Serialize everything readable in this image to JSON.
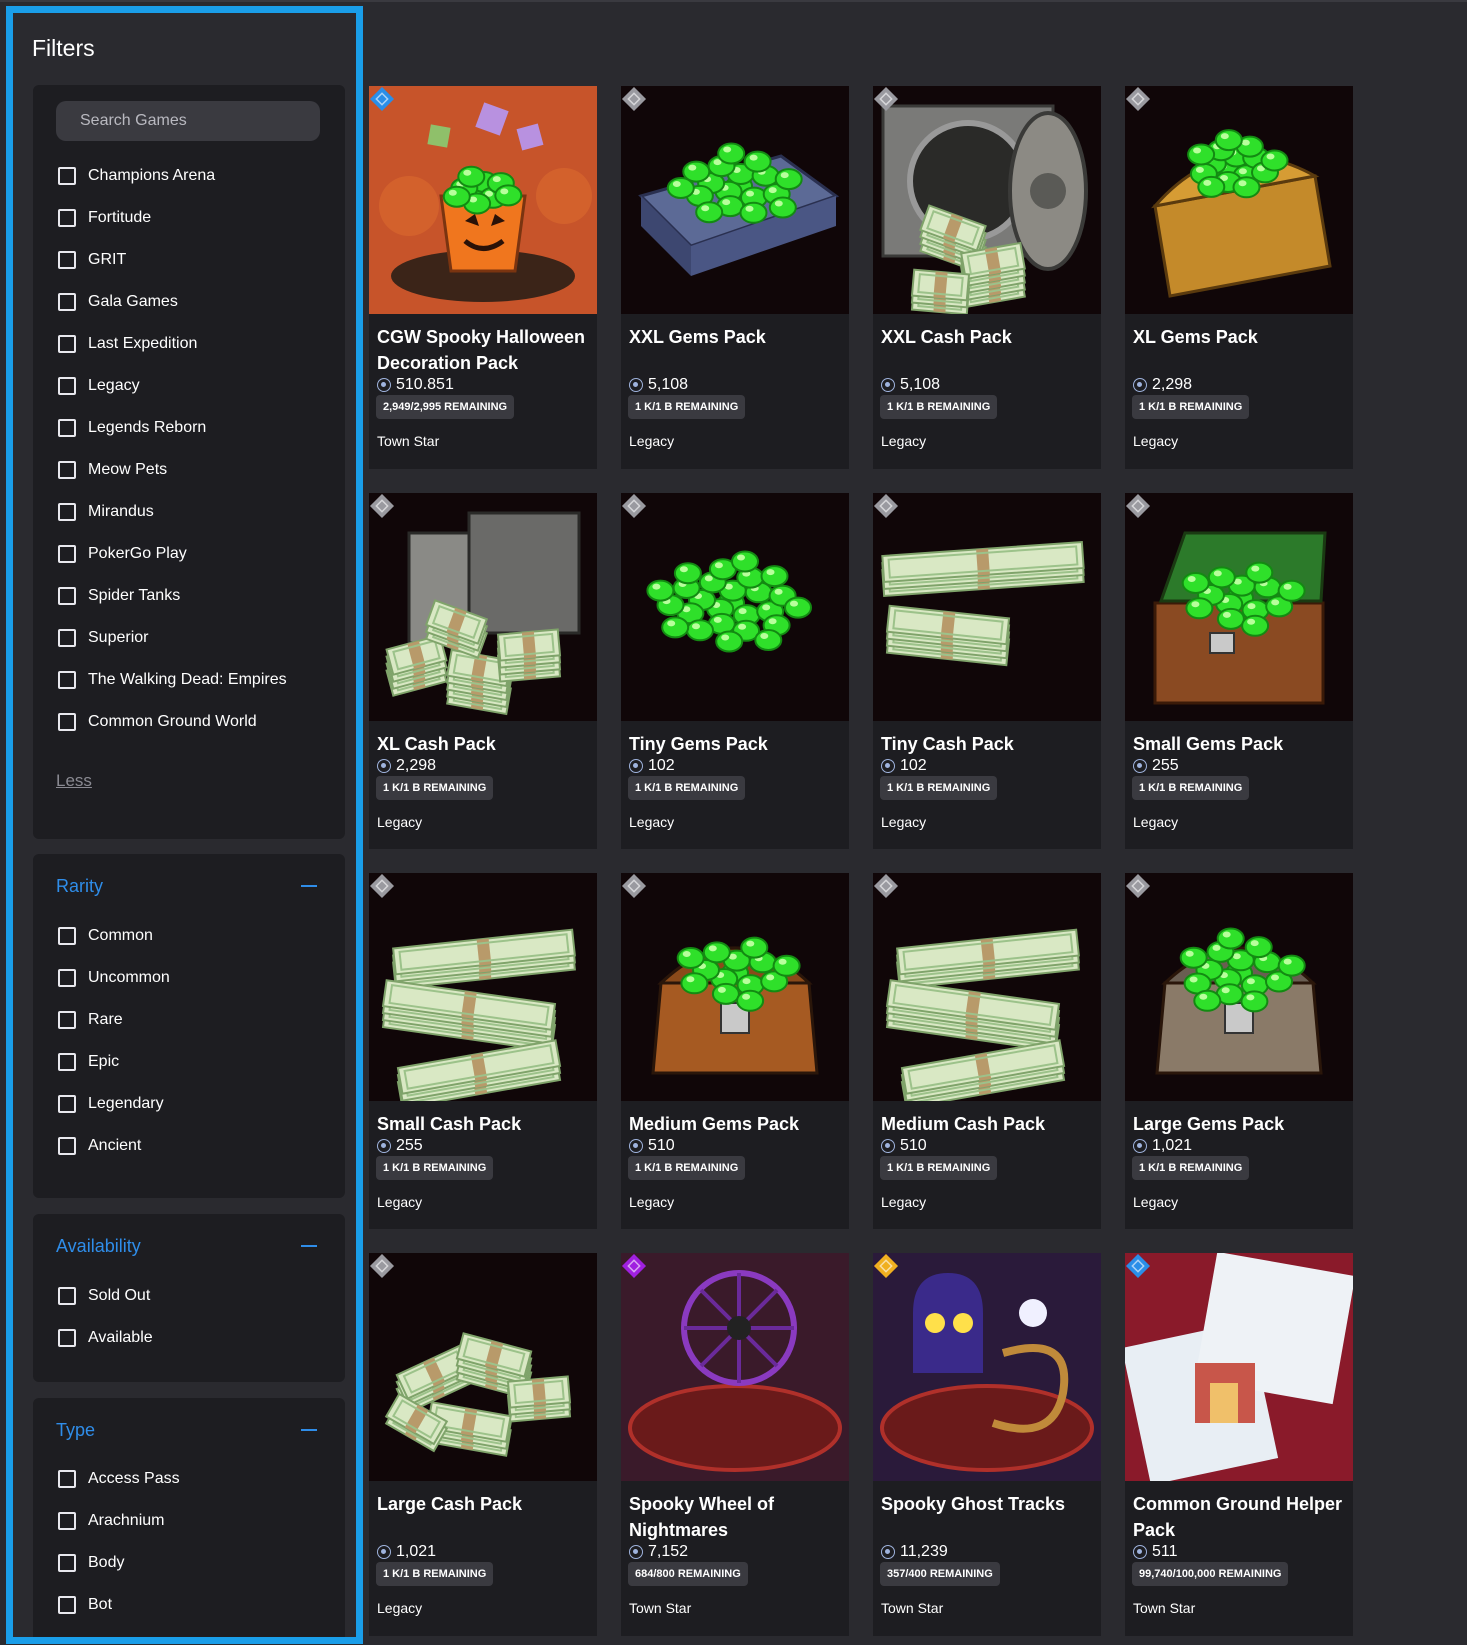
{
  "sidebar": {
    "title": "Filters",
    "search": {
      "placeholder": "Search Games",
      "value": ""
    },
    "games": [
      "Champions Arena",
      "Fortitude",
      "GRIT",
      "Gala Games",
      "Last Expedition",
      "Legacy",
      "Legends Reborn",
      "Meow Pets",
      "Mirandus",
      "PokerGo Play",
      "Spider Tanks",
      "Superior",
      "The Walking Dead: Empires",
      "Common Ground World"
    ],
    "less_label": "Less",
    "rarity": {
      "title": "Rarity",
      "options": [
        "Common",
        "Uncommon",
        "Rare",
        "Epic",
        "Legendary",
        "Ancient"
      ]
    },
    "availability": {
      "title": "Availability",
      "options": [
        "Sold Out",
        "Available"
      ]
    },
    "type": {
      "title": "Type",
      "options": [
        "Access Pass",
        "Arachnium",
        "Body",
        "Bot"
      ]
    }
  },
  "colors": {
    "accent": "#1a9ee9",
    "rarity_common": "#9a9aa0",
    "rarity_rare": "#2a8ee8",
    "rarity_epic": "#a020e0",
    "rarity_legendary": "#f0b020"
  },
  "items": [
    {
      "title": "CGW Spooky Halloween Decoration Pack",
      "price": "510.851",
      "remaining": "2,949/2,995 REMAINING",
      "game": "Town Star",
      "rarity": "rare",
      "art": "halloween"
    },
    {
      "title": "XXL Gems Pack",
      "price": "5,108",
      "remaining": "1 K/1 B REMAINING",
      "game": "Legacy",
      "rarity": "common",
      "art": "gems-crate"
    },
    {
      "title": "XXL Cash Pack",
      "price": "5,108",
      "remaining": "1 K/1 B REMAINING",
      "game": "Legacy",
      "rarity": "common",
      "art": "vault-cash"
    },
    {
      "title": "XL Gems Pack",
      "price": "2,298",
      "remaining": "1 K/1 B REMAINING",
      "game": "Legacy",
      "rarity": "common",
      "art": "gems-chest"
    },
    {
      "title": "XL Cash Pack",
      "price": "2,298",
      "remaining": "1 K/1 B REMAINING",
      "game": "Legacy",
      "rarity": "common",
      "art": "safe-cash"
    },
    {
      "title": "Tiny Gems Pack",
      "price": "102",
      "remaining": "1 K/1 B REMAINING",
      "game": "Legacy",
      "rarity": "common",
      "art": "gems-pile"
    },
    {
      "title": "Tiny Cash Pack",
      "price": "102",
      "remaining": "1 K/1 B REMAINING",
      "game": "Legacy",
      "rarity": "common",
      "art": "cash-small"
    },
    {
      "title": "Small Gems Pack",
      "price": "255",
      "remaining": "1 K/1 B REMAINING",
      "game": "Legacy",
      "rarity": "common",
      "art": "gems-woodchest"
    },
    {
      "title": "Small Cash Pack",
      "price": "255",
      "remaining": "1 K/1 B REMAINING",
      "game": "Legacy",
      "rarity": "common",
      "art": "cash-stack"
    },
    {
      "title": "Medium Gems Pack",
      "price": "510",
      "remaining": "1 K/1 B REMAINING",
      "game": "Legacy",
      "rarity": "common",
      "art": "gems-copperchest"
    },
    {
      "title": "Medium Cash Pack",
      "price": "510",
      "remaining": "1 K/1 B REMAINING",
      "game": "Legacy",
      "rarity": "common",
      "art": "cash-stack"
    },
    {
      "title": "Large Gems Pack",
      "price": "1,021",
      "remaining": "1 K/1 B REMAINING",
      "game": "Legacy",
      "rarity": "common",
      "art": "gems-silverchest"
    },
    {
      "title": "Large Cash Pack",
      "price": "1,021",
      "remaining": "1 K/1 B REMAINING",
      "game": "Legacy",
      "rarity": "common",
      "art": "cash-pile"
    },
    {
      "title": "Spooky Wheel of Nightmares",
      "price": "7,152",
      "remaining": "684/800 REMAINING",
      "game": "Town Star",
      "rarity": "epic",
      "art": "wheel"
    },
    {
      "title": "Spooky Ghost Tracks",
      "price": "11,239",
      "remaining": "357/400 REMAINING",
      "game": "Town Star",
      "rarity": "legendary",
      "art": "ghost-tracks"
    },
    {
      "title": "Common Ground Helper Pack",
      "price": "511",
      "remaining": "99,740/100,000 REMAINING",
      "game": "Town Star",
      "rarity": "rare",
      "art": "helper"
    }
  ]
}
